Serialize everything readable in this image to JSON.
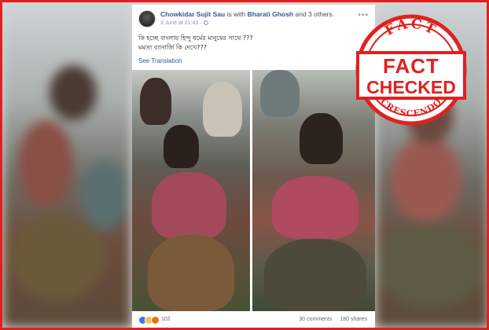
{
  "post": {
    "author": "Chowkidar Sujit Sau",
    "with_text": "is with",
    "tagged": "Bharati Ghosh",
    "and_others": "and 3 others.",
    "date": "3 June at 21:43 ·",
    "text_line1": "কি হচ্ছে বাংলায় হিন্দু ধর্মের মানুষের সাথে ???",
    "text_line2": "মমতা ব্যানার্জি কি দেখে???",
    "see_translation": "See Translation",
    "more_icon": "more-options-icon"
  },
  "engagement": {
    "reactions_count": "102",
    "comments": "30 comments",
    "shares": "180 shares",
    "reaction_icons": [
      "like-icon",
      "haha-icon",
      "angry-icon"
    ]
  },
  "stamp": {
    "top_word": "FACT",
    "big_word_1": "FACT",
    "big_word_2": "CHECKED",
    "bottom_word": "CRESCENDO",
    "color": "#e0211f"
  },
  "colors": {
    "frame": "#e0211f",
    "link": "#365899"
  }
}
